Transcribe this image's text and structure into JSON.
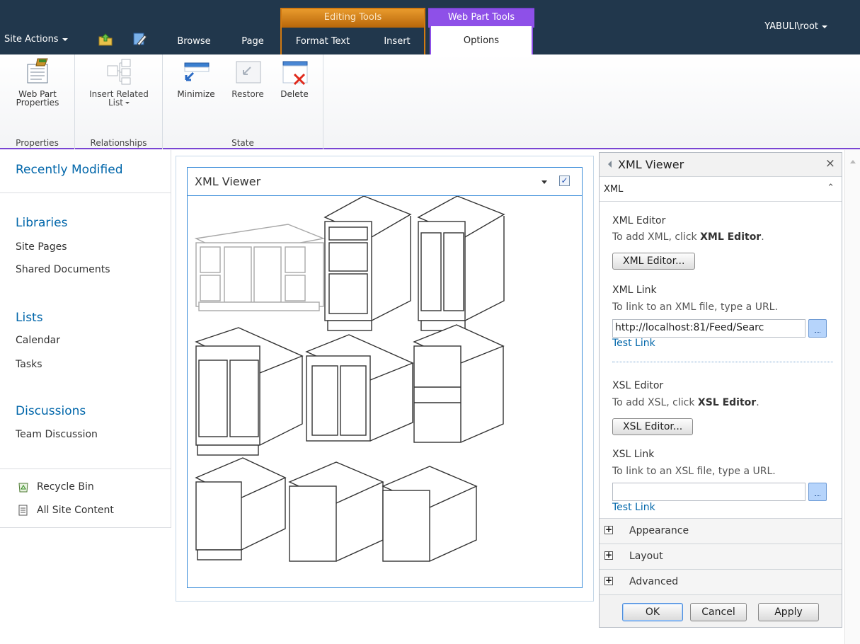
{
  "topbar": {
    "site_actions": "Site Actions",
    "tabs": {
      "browse": "Browse",
      "page": "Page",
      "format_text": "Format Text",
      "insert": "Insert",
      "options": "Options"
    },
    "context_groups": {
      "editing_tools": "Editing Tools",
      "web_part_tools": "Web Part Tools"
    },
    "user": "YABULI\\root"
  },
  "ribbon": {
    "groups": {
      "properties": "Properties",
      "relationships": "Relationships",
      "state": "State"
    },
    "buttons": {
      "web_part_properties_1": "Web Part",
      "web_part_properties_2": "Properties",
      "insert_related_1": "Insert Related",
      "insert_related_2": "List",
      "minimize": "Minimize",
      "restore": "Restore",
      "delete": "Delete"
    }
  },
  "leftnav": {
    "recently_modified": "Recently Modified",
    "libraries": "Libraries",
    "site_pages": "Site Pages",
    "shared_documents": "Shared Documents",
    "lists": "Lists",
    "calendar": "Calendar",
    "tasks": "Tasks",
    "discussions": "Discussions",
    "team_discussion": "Team Discussion",
    "recycle_bin": "Recycle Bin",
    "all_site_content": "All Site Content"
  },
  "webpart": {
    "title": "XML Viewer",
    "checkbox": "✓"
  },
  "toolpane": {
    "title": "XML Viewer",
    "close": "×",
    "section": "XML",
    "collapse": "⌃",
    "xml_editor_label": "XML Editor",
    "xml_editor_hint_prefix": "To add XML, click ",
    "xml_editor_hint_bold": "XML Editor",
    "xml_editor_hint_suffix": ".",
    "xml_editor_button": "XML Editor...",
    "xml_link_label": "XML Link",
    "xml_link_hint": "To link to an XML file, type a URL.",
    "xml_link_value": "http://localhost:81/Feed/Searc",
    "test_link": "Test Link",
    "xsl_editor_label": "XSL Editor",
    "xsl_editor_hint_prefix": "To add XSL, click ",
    "xsl_editor_hint_bold": "XSL Editor",
    "xsl_editor_hint_suffix": ".",
    "xsl_editor_button": "XSL Editor...",
    "xsl_link_label": "XSL Link",
    "xsl_link_hint": "To link to an XSL file, type a URL.",
    "xsl_link_value": "",
    "test_link_2": "Test Link",
    "appearance": "Appearance",
    "layout": "Layout",
    "advanced": "Advanced",
    "ok": "OK",
    "cancel": "Cancel",
    "apply": "Apply"
  },
  "colors": {
    "topbar": "#21374c",
    "editing_tools": "#e89a2c",
    "web_part_tools": "#8e50e8",
    "link": "#0066aa"
  }
}
